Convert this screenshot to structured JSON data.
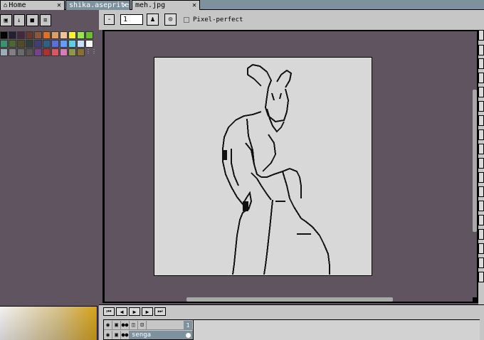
{
  "tabs": [
    {
      "label": "Home",
      "icon": "home-icon"
    },
    {
      "label": "shika.aseprite",
      "active": true
    },
    {
      "label": "meh.jpg"
    }
  ],
  "toolbar_left": {
    "buttons": [
      {
        "icon": "lock-icon",
        "glyph": "🔒"
      },
      {
        "icon": "arrow-down-icon",
        "glyph": "↓"
      },
      {
        "icon": "square-icon",
        "glyph": "■"
      },
      {
        "icon": "menu-icon",
        "glyph": "≡"
      }
    ]
  },
  "palette": {
    "colors": [
      "#000000",
      "#222034",
      "#45283c",
      "#663931",
      "#8f563b",
      "#df7126",
      "#d9a066",
      "#eec39a",
      "#fbf236",
      "#99e550",
      "#6abe30",
      "#37946e",
      "#4b692f",
      "#524b24",
      "#323c39",
      "#3f3f74",
      "#306082",
      "#5b6ee1",
      "#639bff",
      "#5fcde4",
      "#cbdbfc",
      "#ffffff",
      "#9badb7",
      "#847e87",
      "#696a6a",
      "#595652",
      "#76428a",
      "#ac3232",
      "#d95763",
      "#d77bba",
      "#8f974a",
      "#8a6f30"
    ]
  },
  "context_bar": {
    "minus_label": "-",
    "brush_size_value": "1",
    "pixel_perfect_label": "Pixel-perfect",
    "pixel_perfect_checked": false
  },
  "timeline": {
    "controls": [
      {
        "icon": "first-frame-icon",
        "glyph": "⏮"
      },
      {
        "icon": "previous-frame-icon",
        "glyph": "◀"
      },
      {
        "icon": "play-icon",
        "glyph": "▶"
      },
      {
        "icon": "next-frame-icon",
        "glyph": "▶"
      },
      {
        "icon": "last-frame-icon",
        "glyph": "⏭"
      }
    ],
    "frame_number": "1",
    "layer_name": "senga"
  },
  "colors": {
    "tab_bar": "#7d929e",
    "panel": "#c6c6c6",
    "workspace": "#5f5460",
    "sprite_bg": "#d8d8d8"
  }
}
